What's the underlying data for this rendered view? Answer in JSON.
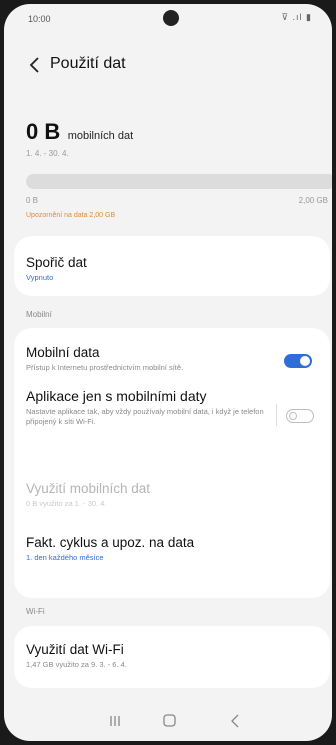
{
  "status_bar": {
    "time": "10:00",
    "icons_text": "⊽ .ıl ▮"
  },
  "header": {
    "title": "Použití dat"
  },
  "usage": {
    "value": "0 B",
    "unit": "mobilních dat",
    "period": "1. 4. - 30. 4.",
    "progress_fraction": 0,
    "scale_min": "0 B",
    "scale_max": "2,00 GB",
    "warning": "Upozornění na data 2,00 GB"
  },
  "data_saver": {
    "title": "Spořič dat",
    "status": "Vypnuto"
  },
  "sections": {
    "mobile": "Mobilní",
    "wifi": "Wi-Fi"
  },
  "mobile_data": {
    "title": "Mobilní data",
    "subtitle": "Přístup k Internetu prostřednictvím mobilní sítě.",
    "enabled": true
  },
  "mobile_only_apps": {
    "title": "Aplikace jen s mobilními daty",
    "subtitle": "Nastavte aplikace tak, aby vždy používaly mobilní data, i když je telefon připojený k síti Wi-Fi.",
    "enabled": false
  },
  "mobile_usage": {
    "title": "Využití mobilních dat",
    "subtitle": "0 B využito za 1. - 30. 4."
  },
  "billing_cycle": {
    "title": "Fakt. cyklus a upoz. na data",
    "subtitle": "1. den každého měsíce"
  },
  "wifi_usage": {
    "title": "Využití dat Wi-Fi",
    "subtitle": "1,47 GB využito za 9. 3. - 6. 4."
  },
  "colors": {
    "accent": "#2f6ed6",
    "warning": "#e08a3a",
    "background": "#f3f3f3"
  },
  "nav_icons": [
    "recent-apps-icon",
    "home-icon",
    "back-icon"
  ]
}
